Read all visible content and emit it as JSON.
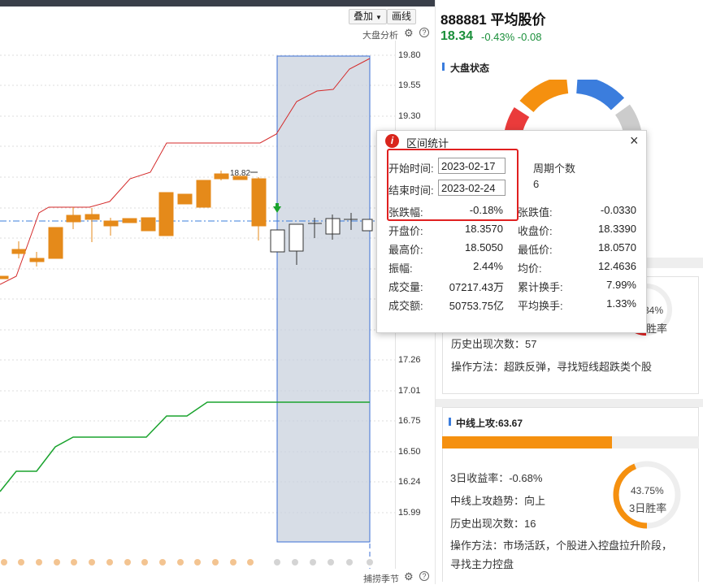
{
  "toolbar": {
    "overlay_label": "叠加",
    "draw_label": "画线",
    "analysis_label": "大盘分析"
  },
  "price_axis": [
    "19.80",
    "19.55",
    "19.30",
    "17.26",
    "17.01",
    "16.75",
    "16.50",
    "16.24",
    "15.99"
  ],
  "chart_annotation": "18.82",
  "footer": {
    "season_label": "捕捞季节"
  },
  "stock": {
    "title": "888881 平均股价",
    "price": "18.34",
    "change": "-0.43% -0.08"
  },
  "market_status": {
    "title": "大盘状态",
    "gauge_colors": [
      "#ea3b3b",
      "#f5900f",
      "#3b7ddd",
      "#cccccc"
    ]
  },
  "card1": {
    "ring_pct": "34%",
    "ring_label": "胜率",
    "history_count": "历史出现次数：57",
    "method": "操作方法：超跌反弹，寻找短线超跌类个股"
  },
  "card2": {
    "title": "中线上攻:63.67",
    "progress": 0.66,
    "return_3d": "3日收益率：-0.68%",
    "trend": "中线上攻趋势：向上",
    "history_count": "历史出现次数：16",
    "method_line1": "操作方法：市场活跃，个股进入控盘拉升阶段，",
    "method_line2": "寻找主力控盘",
    "ring_pct": "43.75%",
    "ring_label": "3日胜率",
    "ring_fraction": 0.4375
  },
  "popup": {
    "title": "区间统计",
    "start_label": "开始时间:",
    "start_value": "2023-02-17",
    "end_label": "结束时间:",
    "end_value": "2023-02-24",
    "period_label": "周期个数",
    "period_value": "6",
    "change_pct_label": "张跌幅:",
    "change_pct_value": "-0.18%",
    "change_val_label": "张跌值:",
    "change_val_value": "-0.0330",
    "open_label": "开盘价:",
    "open_value": "18.3570",
    "close_label": "收盘价:",
    "close_value": "18.3390",
    "high_label": "最高价:",
    "high_value": "18.5050",
    "low_label": "最低价:",
    "low_value": "18.0570",
    "amplitude_label": "振幅:",
    "amplitude_value": "2.44%",
    "avg_label": "均价:",
    "avg_value": "12.4636",
    "volume_label": "成交量:",
    "volume_value": "07217.43万",
    "turnover_cum_label": "累计换手:",
    "turnover_cum_value": "7.99%",
    "amount_label": "成交额:",
    "amount_value": "50753.75亿",
    "turnover_avg_label": "平均换手:",
    "turnover_avg_value": "1.33%"
  }
}
